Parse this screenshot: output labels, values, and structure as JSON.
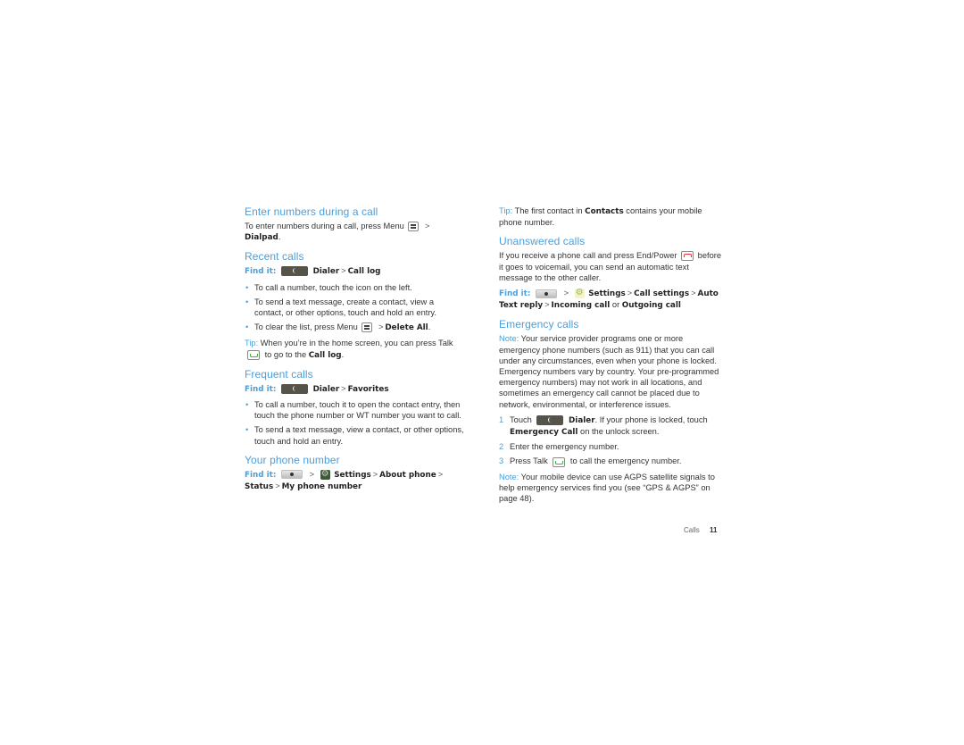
{
  "left": {
    "enter_numbers": {
      "heading": "Enter numbers during a call",
      "text_pre": "To enter numbers during a call, press Menu",
      "gt": ">",
      "target": "Dialpad",
      "period": "."
    },
    "recent_calls": {
      "heading": "Recent calls",
      "find_it_label": "Find it:",
      "path": [
        "Dialer",
        "Call log"
      ],
      "bullets": [
        "To call a number, touch the icon on the left.",
        "To send a text message, create a contact, view a contact, or other options, touch and hold an entry."
      ],
      "clear_pre": "To clear the list, press Menu",
      "clear_target": "Delete All",
      "tip_label": "Tip:",
      "tip_pre": "When you’re in the home screen, you can press Talk",
      "tip_mid": "to go to the",
      "tip_target": "Call log"
    },
    "frequent_calls": {
      "heading": "Frequent calls",
      "find_it_label": "Find it:",
      "path": [
        "Dialer",
        "Favorites"
      ],
      "bullets": [
        "To call a number, touch it to open the contact entry, then touch the phone number or WT number you want to call.",
        "To send a text message, view a contact, or other options, touch and hold an entry."
      ]
    },
    "your_phone_number": {
      "heading": "Your phone number",
      "find_it_label": "Find it:",
      "path": [
        "Settings",
        "About phone",
        "Status",
        "My phone number"
      ]
    }
  },
  "right": {
    "tip": {
      "label": "Tip:",
      "pre": "The first contact in",
      "target": "Contacts",
      "post": "contains your mobile phone number."
    },
    "unanswered_calls": {
      "heading": "Unanswered calls",
      "text_pre": "If you receive a phone call and press End/Power",
      "text_post": "before it goes to voicemail, you can send an automatic text message to the other caller.",
      "find_it_label": "Find it:",
      "path": [
        "Settings",
        "Call settings",
        "Auto Text reply",
        "Incoming call"
      ],
      "or_word": "or",
      "alt": "Outgoing call"
    },
    "emergency_calls": {
      "heading": "Emergency calls",
      "note_label": "Note:",
      "note_text": "Your service provider programs one or more emergency phone numbers (such as 911) that you can call under any circumstances, even when your phone is locked. Emergency numbers vary by country. Your pre-programmed emergency numbers) may not work in all locations, and sometimes an emergency call cannot be placed due to network, environmental, or interference issues.",
      "steps": [
        {
          "num": "1",
          "pre": "Touch",
          "bold1": "Dialer",
          "mid": ". If your phone is locked, touch",
          "bold2": "Emergency Call",
          "post": "on the unlock screen."
        },
        {
          "num": "2",
          "text": "Enter the emergency number."
        },
        {
          "num": "3",
          "pre": "Press Talk",
          "post": "to call the emergency number."
        }
      ],
      "note2_label": "Note:",
      "note2_text": "Your mobile device can use AGPS satellite signals to help emergency services find you (see “GPS & AGPS” on page 48)."
    }
  },
  "footer": {
    "section": "Calls",
    "page": "11"
  },
  "icons": {
    "menu": "menu-key-icon",
    "dialer": "dialer-phone-icon",
    "talk": "talk-key-icon",
    "end": "end-power-key-icon",
    "home": "home-key-icon",
    "settings": "settings-gear-icon"
  },
  "colors": {
    "accent": "#4a9fdc",
    "text": "#333333",
    "talk_green": "#3db03d",
    "end_red": "#e0353a"
  }
}
